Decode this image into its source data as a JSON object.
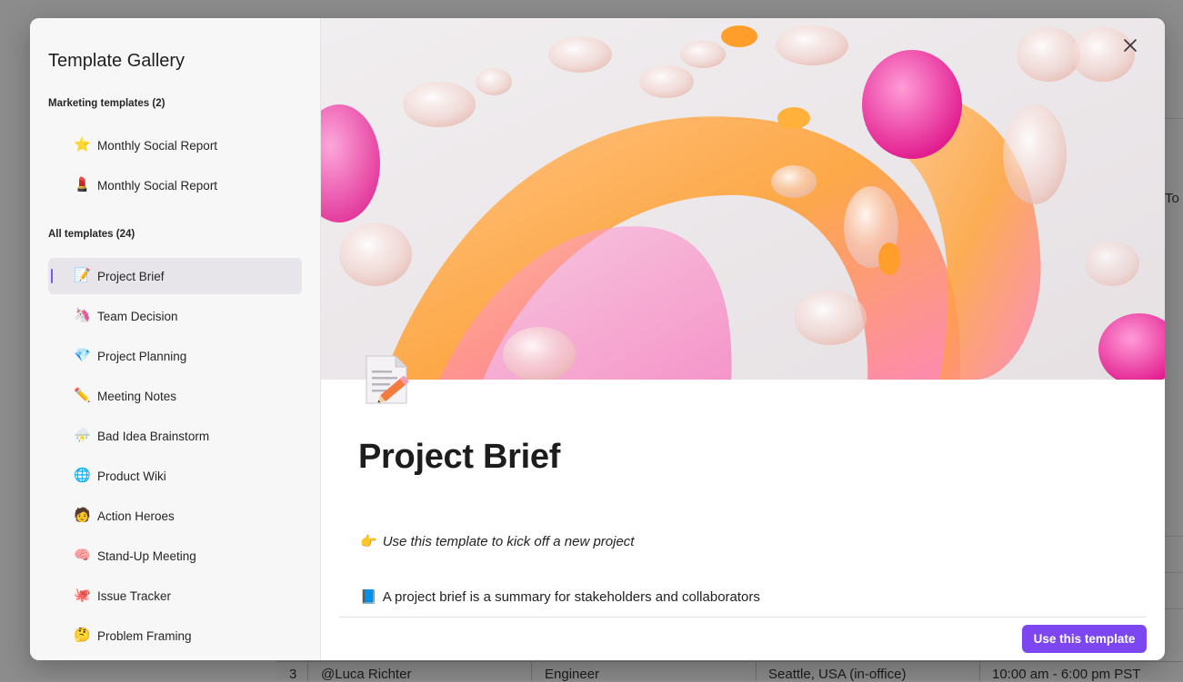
{
  "modal": {
    "title": "Template Gallery",
    "sections": [
      {
        "label": "Marketing templates (2)",
        "items": [
          {
            "emoji": "⭐",
            "label": "Monthly Social Report"
          },
          {
            "emoji": "💄",
            "label": "Monthly Social Report"
          }
        ]
      },
      {
        "label": "All templates (24)",
        "items": [
          {
            "emoji": "📝",
            "label": "Project Brief",
            "selected": true
          },
          {
            "emoji": "🦄",
            "label": "Team Decision"
          },
          {
            "emoji": "💎",
            "label": "Project Planning"
          },
          {
            "emoji": "✏️",
            "label": "Meeting Notes"
          },
          {
            "emoji": "⛈️",
            "label": "Bad Idea Brainstorm"
          },
          {
            "emoji": "🌐",
            "label": "Product Wiki"
          },
          {
            "emoji": "🧑",
            "label": "Action Heroes"
          },
          {
            "emoji": "🧠",
            "label": "Stand-Up Meeting"
          },
          {
            "emoji": "🐙",
            "label": "Issue Tracker"
          },
          {
            "emoji": "🤔",
            "label": "Problem Framing"
          }
        ]
      }
    ],
    "preview": {
      "icon": "memo-icon",
      "title": "Project Brief",
      "line1_emoji": "👉",
      "line1_text": "Use this template to kick off a new project",
      "line2_emoji": "📘",
      "line2_text": "A project brief is a summary for stakeholders and collaborators"
    },
    "use_button": "Use this template",
    "close_icon": "close-icon",
    "accent_color": "#7c46f0"
  },
  "background": {
    "header_partial": "To",
    "row": {
      "index": "3",
      "name": "@Luca Richter",
      "role": "Engineer",
      "location": "Seattle, USA (in-office)",
      "hours": "10:00 am - 6:00 pm PST"
    }
  }
}
